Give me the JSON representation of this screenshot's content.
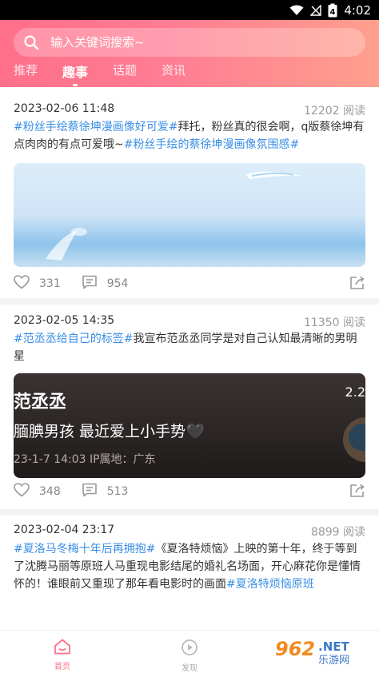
{
  "status_bar": {
    "time": "4:02",
    "battery": "4"
  },
  "search": {
    "placeholder": "输入关键词搜索~"
  },
  "tabs": [
    {
      "label": "推荐"
    },
    {
      "label": "趣事"
    },
    {
      "label": "话题"
    },
    {
      "label": "资讯"
    }
  ],
  "active_tab_index": 1,
  "posts": [
    {
      "time": "2023-02-06 11:48",
      "views": "12202 阅读",
      "text": [
        {
          "tag": "#粉丝手绘蔡徐坤漫画像好可爱#"
        },
        {
          "plain": "拜托，粉丝真的很会啊，q版蔡徐坤有点肉肉的有点可爱哦~"
        },
        {
          "tag": "#粉丝手绘的蔡徐坤漫画像氛围感#"
        }
      ],
      "likes": "331",
      "comments": "954"
    },
    {
      "time": "2023-02-05 14:35",
      "views": "11350 阅读",
      "text": [
        {
          "tag": "#范丞丞给自己的标签#"
        },
        {
          "plain": "我宣布范丞丞同学是对自己认知最清晰的男明星"
        }
      ],
      "image_overlay": {
        "title": "范丞丞",
        "subtitle": "腼腆男孩 最近爱上小手势🖤",
        "meta": "23-1-7 14:03  IP属地：广东",
        "corner": "2.2"
      },
      "likes": "348",
      "comments": "513"
    },
    {
      "time": "2023-02-04 23:17",
      "views": "8899 阅读",
      "text": [
        {
          "tag": "#夏洛马冬梅十年后再拥抱#"
        },
        {
          "plain": "《夏洛特烦恼》上映的第十年，终于等到了沈腾马丽等原班人马重现电影结尾的婚礼名场面，开心麻花你是懂情怀的！谁眼前又重现了那年看电影时的画面"
        },
        {
          "tag": "#夏洛特烦恼原班"
        }
      ]
    }
  ],
  "bottom_nav": [
    {
      "label": "首页",
      "icon": "home-icon"
    },
    {
      "label": "发现",
      "icon": "discover-icon"
    }
  ],
  "watermark": {
    "brand": "962",
    "suffix": ".NET",
    "sub": "乐游网"
  },
  "colors": {
    "accent": "#ff6f8a",
    "tag": "#3a8ee6",
    "header_end": "#ff9f8d"
  }
}
